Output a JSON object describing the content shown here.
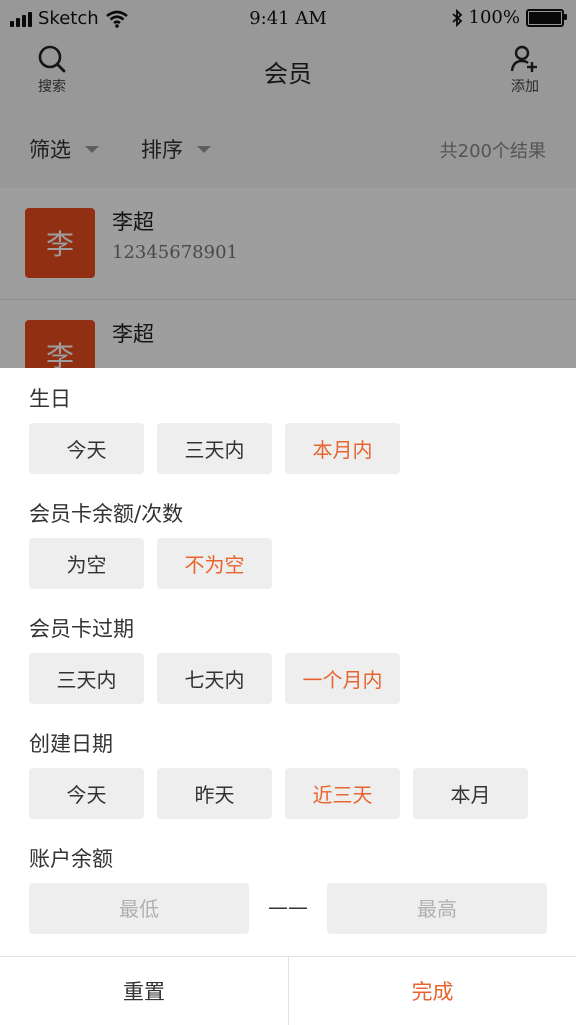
{
  "status_bar": {
    "carrier": "Sketch",
    "time": "9:41 AM",
    "battery": "100%"
  },
  "nav": {
    "title": "会员",
    "search_label": "搜索",
    "add_label": "添加"
  },
  "filter_bar": {
    "filter_label": "筛选",
    "sort_label": "排序",
    "result_count": "共200个结果"
  },
  "members": [
    {
      "avatar_char": "李",
      "name": "李超",
      "phone": "12345678901"
    },
    {
      "avatar_char": "李",
      "name": "李超",
      "phone": ""
    }
  ],
  "filters": {
    "birthday": {
      "title": "生日",
      "options": [
        "今天",
        "三天内",
        "本月内"
      ],
      "selected": "本月内"
    },
    "card_balance": {
      "title": "会员卡余额/次数",
      "options": [
        "为空",
        "不为空"
      ],
      "selected": "不为空"
    },
    "card_expiry": {
      "title": "会员卡过期",
      "options": [
        "三天内",
        "七天内",
        "一个月内"
      ],
      "selected": "一个月内"
    },
    "created_date": {
      "title": "创建日期",
      "options": [
        "今天",
        "昨天",
        "近三天",
        "本月"
      ],
      "selected": "近三天"
    },
    "account_balance": {
      "title": "账户余额",
      "min_placeholder": "最低",
      "max_placeholder": "最高",
      "separator": "——"
    }
  },
  "footer": {
    "reset_label": "重置",
    "done_label": "完成"
  },
  "colors": {
    "accent": "#e8642f",
    "avatar": "#e84c1e",
    "chip_bg": "#eeeeee"
  }
}
